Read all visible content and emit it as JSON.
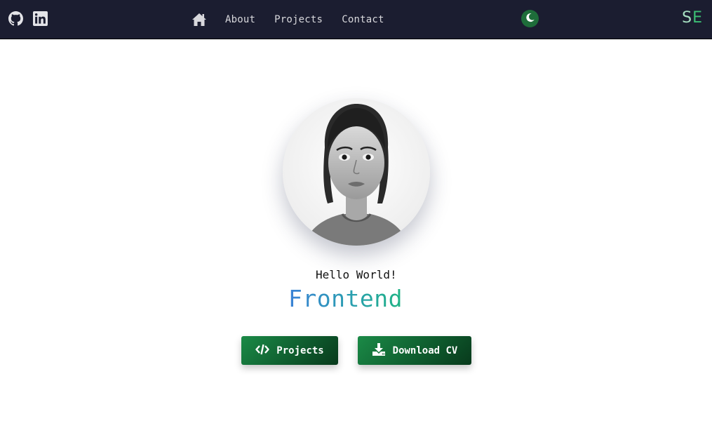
{
  "nav": {
    "social": [
      {
        "icon": "github-icon"
      },
      {
        "icon": "linkedin-icon"
      }
    ],
    "home_icon": "home-icon",
    "links": [
      "About",
      "Projects",
      "Contact"
    ],
    "theme_icon": "moon-icon",
    "logo": {
      "first": "S",
      "second": "E"
    }
  },
  "hero": {
    "avatar_alt": "portrait",
    "greeting": "Hello World!",
    "role": "Frontend",
    "buttons": {
      "projects": {
        "label": "Projects",
        "icon": "code-icon"
      },
      "cv": {
        "label": "Download CV",
        "icon": "download-icon"
      }
    }
  },
  "colors": {
    "navbar_bg": "#1b1d30",
    "button_green": "#0f5e2f",
    "accent_green": "#3cbf74",
    "role_gradient_start": "#3b82d6",
    "role_gradient_end": "#1fb384"
  }
}
